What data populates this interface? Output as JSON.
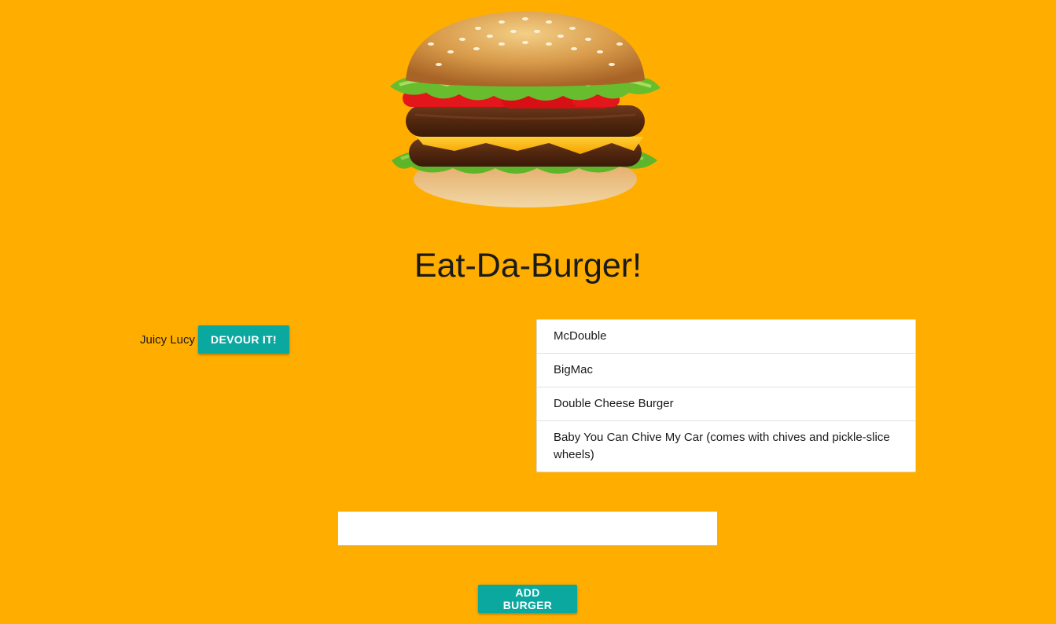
{
  "hero": {
    "image": "cheeseburger-image"
  },
  "header": {
    "title": "Eat-Da-Burger!"
  },
  "pending": {
    "items": [
      {
        "name": "Juicy Lucy",
        "button_label": "DEVOUR IT!"
      }
    ]
  },
  "devoured": {
    "items": [
      "McDouble",
      "BigMac",
      "Double Cheese Burger",
      "Baby You Can Chive My Car (comes with chives and pickle-slice wheels)"
    ]
  },
  "form": {
    "input_value": "",
    "input_placeholder": "",
    "submit_label": "ADD BURGER"
  },
  "colors": {
    "background": "#FFAE00",
    "button": "#0AA89E"
  }
}
